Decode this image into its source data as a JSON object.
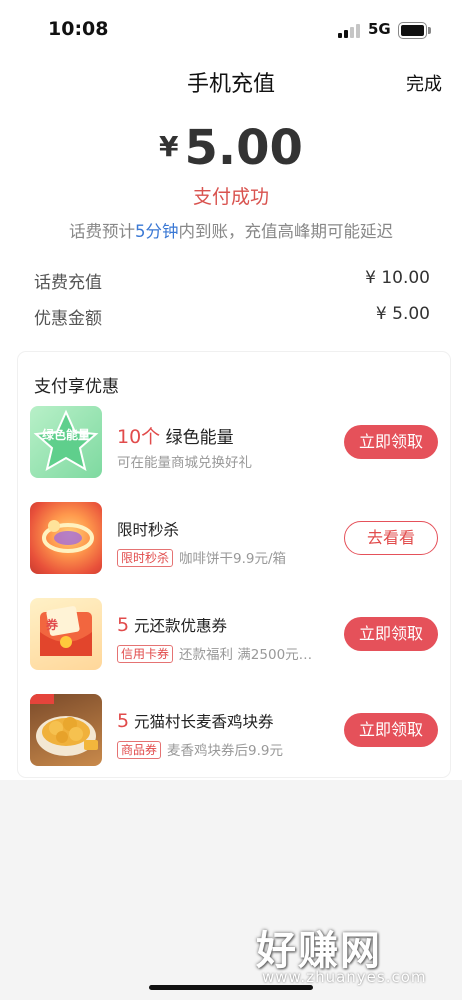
{
  "status_bar": {
    "time": "10:08",
    "network": "5G"
  },
  "nav": {
    "title": "手机充值",
    "done": "完成"
  },
  "payment": {
    "currency": "¥",
    "amount": "5.00",
    "status": "支付成功",
    "eta_prefix": "话费预计",
    "eta_highlight": "5分钟",
    "eta_suffix": "内到账，充值高峰期可能延迟"
  },
  "details": [
    {
      "label": "话费充值",
      "value": "¥ 10.00"
    },
    {
      "label": "优惠金额",
      "value": "¥ 5.00"
    }
  ],
  "offers_card": {
    "title": "支付享优惠",
    "offers": [
      {
        "num": "10个",
        "title": "绿色能量",
        "tag": "",
        "sub": "可在能量商城兑换好礼",
        "button": "立即领取",
        "thumb_text": "绿色能量"
      },
      {
        "num": "",
        "title": "限时秒杀",
        "tag": "限时秒杀",
        "sub": "咖啡饼干9.9元/箱",
        "button": "去看看"
      },
      {
        "num": "5",
        "title": "元还款优惠券",
        "tag": "信用卡券",
        "sub": "还款福利 满2500元…",
        "button": "立即领取",
        "thumb_text": "券"
      },
      {
        "num": "5",
        "title": "元猫村长麦香鸡块券",
        "tag": "商品券",
        "sub": "麦香鸡块券后9.9元",
        "button": "立即领取"
      }
    ]
  },
  "watermark": {
    "cn": "好赚网",
    "en": "www.zhuanyes.com"
  },
  "colors": {
    "accent": "#e5515a",
    "highlight_blue": "#3a78d4",
    "success_red": "#d9534f"
  }
}
